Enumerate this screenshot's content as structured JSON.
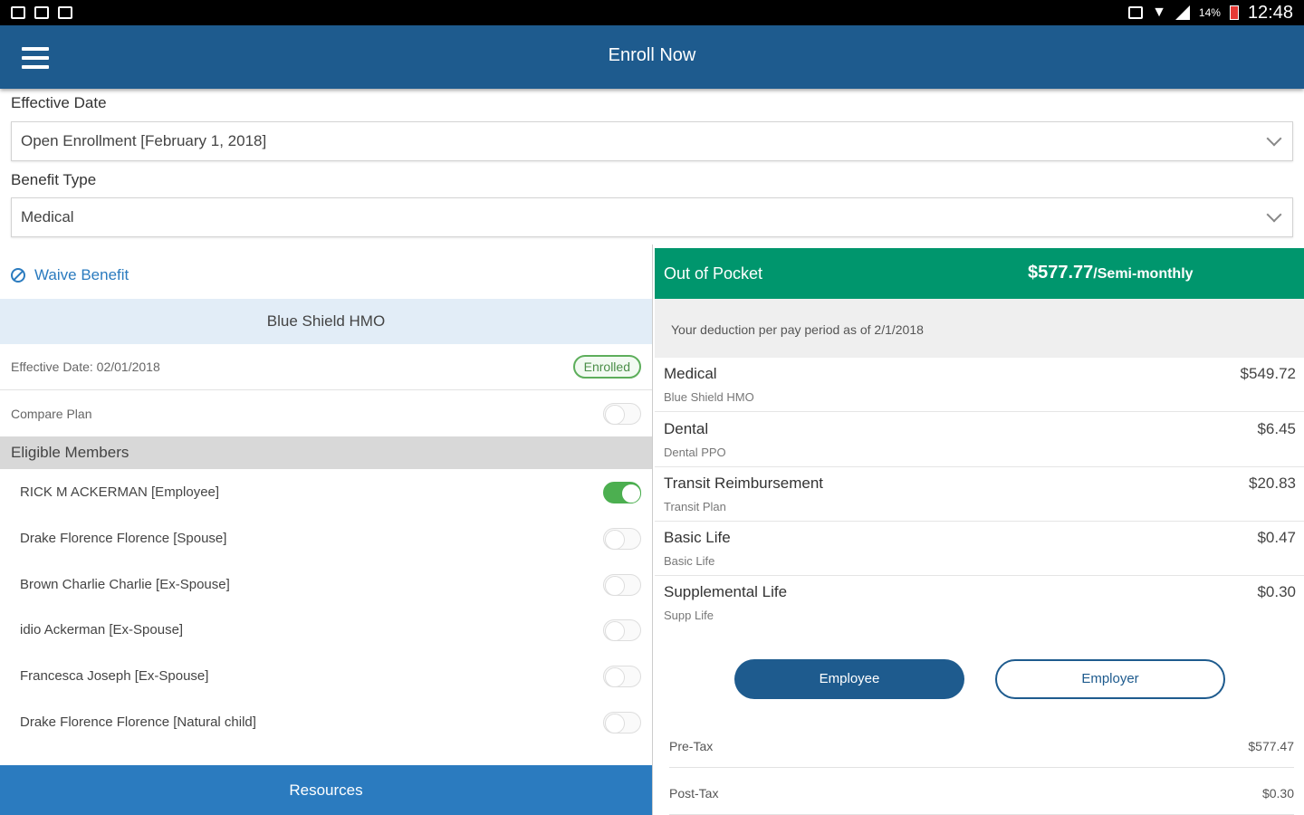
{
  "status_bar": {
    "time": "12:48",
    "battery": "14%"
  },
  "app_bar": {
    "title": "Enroll Now",
    "menu_icon": "hamburger-menu-icon"
  },
  "form": {
    "effective_date_label": "Effective Date",
    "effective_date_value": "Open Enrollment [February 1, 2018]",
    "benefit_type_label": "Benefit Type",
    "benefit_type_value": "Medical"
  },
  "left_panel": {
    "waive_label": "Waive Benefit",
    "plan_name": "Blue Shield HMO",
    "effective_date_text": "Effective Date: 02/01/2018",
    "status_badge": "Enrolled",
    "compare_plan_label": "Compare Plan",
    "section_title": "Eligible Members",
    "members": [
      {
        "name": "RICK M ACKERMAN [Employee]",
        "selected": true
      },
      {
        "name": "Drake Florence Florence [Spouse]",
        "selected": false
      },
      {
        "name": "Brown Charlie Charlie [Ex-Spouse]",
        "selected": false
      },
      {
        "name": "idio Ackerman [Ex-Spouse]",
        "selected": false
      },
      {
        "name": "Francesca Joseph [Ex-Spouse]",
        "selected": false
      },
      {
        "name": "Drake Florence Florence [Natural child]",
        "selected": false
      }
    ],
    "resources_label": "Resources"
  },
  "right_panel": {
    "out_of_pocket_label": "Out of Pocket",
    "out_of_pocket_amount": "$577.77",
    "out_of_pocket_period": "/Semi-monthly",
    "deduction_note": "Your deduction per pay period as of 2/1/2018",
    "deductions": [
      {
        "name": "Medical",
        "plan": "Blue Shield HMO",
        "amount": "$549.72"
      },
      {
        "name": "Dental",
        "plan": "Dental PPO",
        "amount": "$6.45"
      },
      {
        "name": "Transit Reimbursement",
        "plan": "Transit Plan",
        "amount": "$20.83"
      },
      {
        "name": "Basic Life",
        "plan": "Basic Life",
        "amount": "$0.47"
      },
      {
        "name": "Supplemental Life",
        "plan": "Supp Life",
        "amount": "$0.30"
      }
    ],
    "employee_button": "Employee",
    "employer_button": "Employer",
    "tax_rows": [
      {
        "label": "Pre-Tax",
        "amount": "$577.47"
      },
      {
        "label": "Post-Tax",
        "amount": "$0.30"
      }
    ]
  },
  "colors": {
    "primary": "#1e5b8e",
    "accent": "#2b7bbf",
    "oop_green": "#00966d",
    "toggle_on": "#4caf50"
  }
}
